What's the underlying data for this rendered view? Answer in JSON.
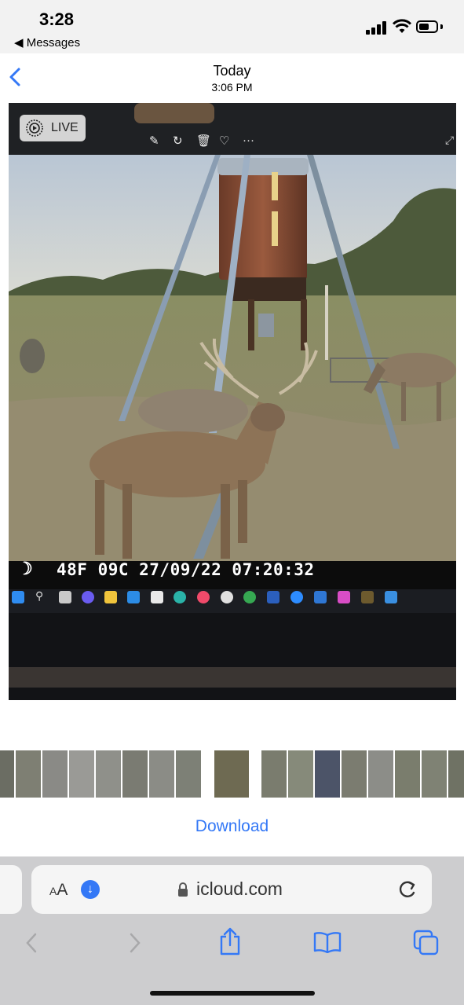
{
  "status_bar": {
    "time": "3:28",
    "back_app": "◀ Messages"
  },
  "header": {
    "title": "Today",
    "subtitle": "3:06 PM"
  },
  "photo": {
    "live_label": "LIVE",
    "camera_stamp": "48F 09C 27/09/22 07:20:32",
    "moon_glyph": "☽",
    "toolbar_icons": [
      "markup-icon",
      "rotate-icon",
      "trash-icon",
      "heart-icon",
      "more-icon"
    ],
    "expand_icon": "expand-icon"
  },
  "thumbnails": {
    "count": 17
  },
  "download_label": "Download",
  "safari": {
    "text_size_label_small": "A",
    "text_size_label_large": "A",
    "url": "icloud.com",
    "colors": {
      "accent": "#3478f6",
      "toolbar_bg": "#cdcdcf"
    }
  }
}
